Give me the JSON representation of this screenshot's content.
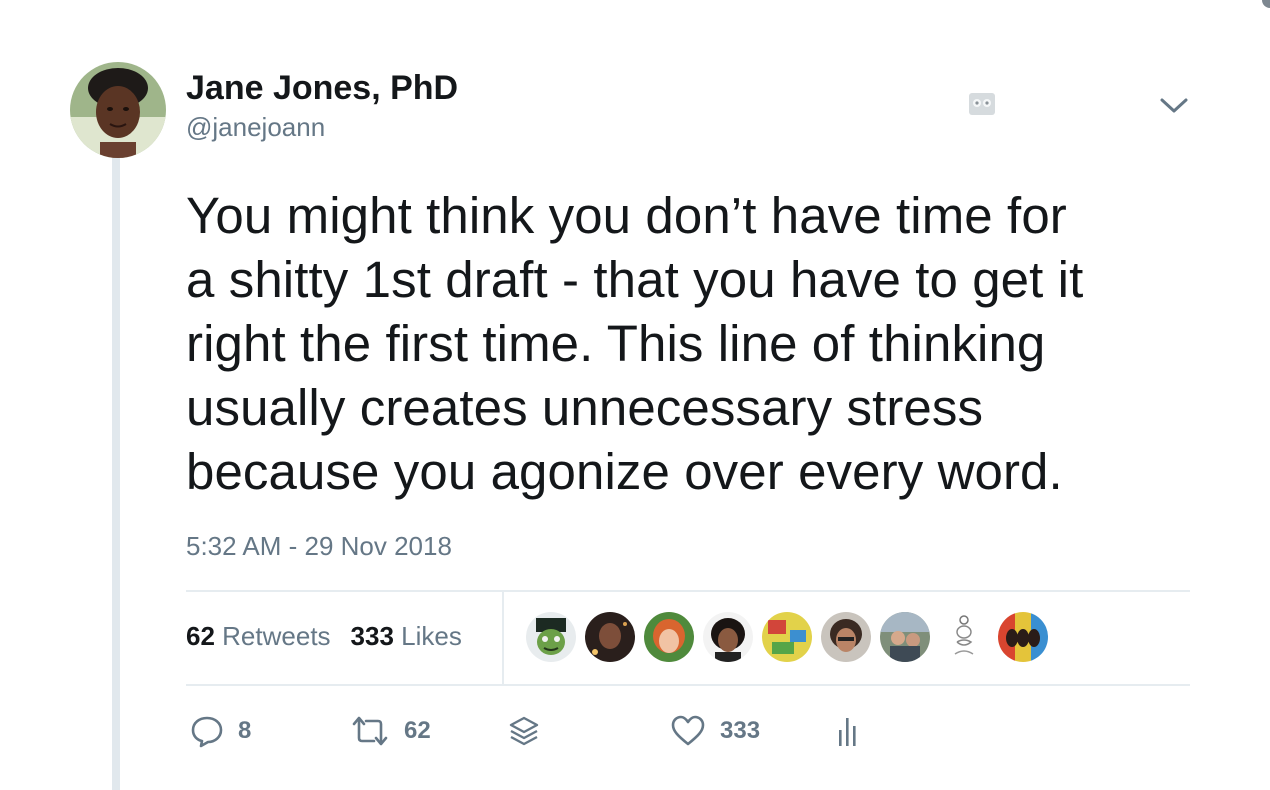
{
  "tweet": {
    "display_name": "Jane Jones, PhD",
    "handle": "@janejoann",
    "text_lines": [
      "You might think you don’t have time for",
      "a shitty 1st draft - that you have to get it",
      "right the first time. This line of thinking",
      "usually creates unnecessary stress",
      "because you agonize over every word."
    ],
    "timestamp": "5:32 AM - 29 Nov 2018"
  },
  "stats": {
    "retweets_count": "62",
    "retweets_label": "Retweets",
    "likes_count": "333",
    "likes_label": "Likes"
  },
  "actions": {
    "reply_count": "8",
    "retweet_count": "62",
    "like_count": "333"
  },
  "icons": {
    "header": [
      "owl-icon",
      "chevron-down-icon"
    ],
    "actions": [
      "reply-icon",
      "retweet-icon",
      "stack-icon",
      "heart-icon",
      "analytics-icon"
    ]
  },
  "colors": {
    "text": "#14171a",
    "secondary": "#657786",
    "divider": "#e6ecf0",
    "thread_line": "#e1e8ed"
  }
}
